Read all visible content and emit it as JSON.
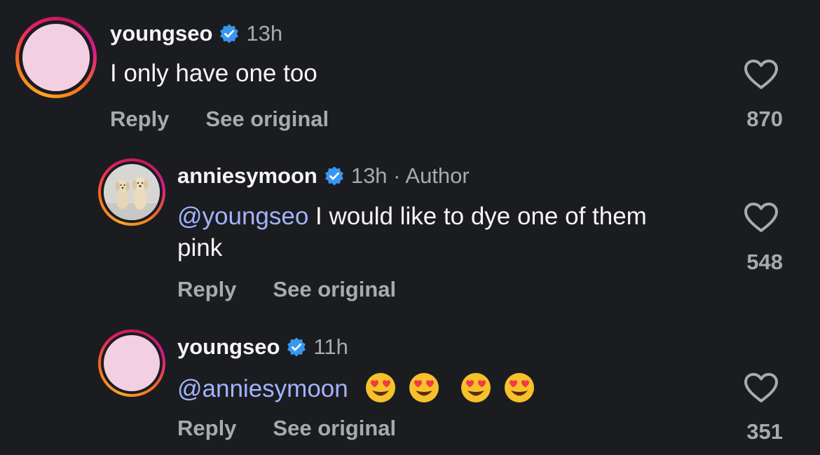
{
  "comments": [
    {
      "username": "youngseo",
      "time": "13h",
      "text": "I only have one too",
      "reply_label": "Reply",
      "see_original_label": "See original",
      "likes": "870"
    },
    {
      "username": "anniesymoon",
      "time": "13h · Author",
      "mention": "@youngseo",
      "text": " I would like to dye one of them pink",
      "reply_label": "Reply",
      "see_original_label": "See original",
      "likes": "548"
    },
    {
      "username": "youngseo",
      "time": "11h",
      "mention": "@anniesymoon",
      "emojis": [
        "heart-eyes-emoji",
        "heart-eyes-emoji",
        "heart-eyes-emoji",
        "heart-eyes-emoji"
      ],
      "reply_label": "Reply",
      "see_original_label": "See original",
      "likes": "351"
    }
  ],
  "colors": {
    "background": "#1b1c1f",
    "verified_badge": "#3897f0",
    "mention": "#a3b3ff",
    "secondary_text": "#a8aab0"
  }
}
